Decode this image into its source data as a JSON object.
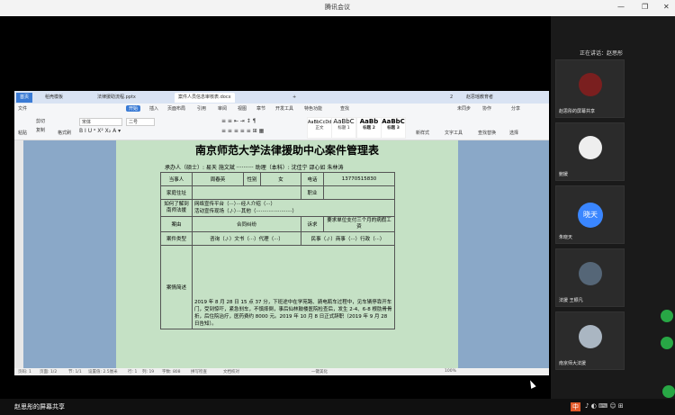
{
  "window": {
    "title": "腾讯会议",
    "min": "—",
    "max": "❐",
    "close": "✕"
  },
  "wps": {
    "tabs": [
      "首页",
      "稻壳模板",
      "法律援助流程.pptx",
      "案件人员信息审核表.docx"
    ],
    "tab_add": "+",
    "tab_count": "2",
    "user": "赵思瑶教育者",
    "menus": [
      "文件",
      "开始",
      "插入",
      "页面布局",
      "引用",
      "审阅",
      "视图",
      "章节",
      "开发工具",
      "特色功能",
      "查找"
    ],
    "tools": {
      "paste": "粘贴",
      "cut": "剪切",
      "copy": "复制",
      "format_painter": "格式刷",
      "font": "宋体",
      "size": "二号",
      "text_tools": "文字工具",
      "find_replace": "查找替换",
      "select": "选择",
      "new_style": "新样式",
      "share": "分享",
      "collab": "未同步",
      "feedback": "协作"
    },
    "styles": [
      {
        "sample": "AaBbCcDd",
        "label": "正文"
      },
      {
        "sample": "AaBbC",
        "label": "标题 1"
      },
      {
        "sample": "AaBb",
        "label": "标题 2"
      },
      {
        "sample": "AaBbC",
        "label": "标题 3"
      }
    ],
    "status": {
      "page": "页码: 1",
      "pages": "页面: 1/2",
      "section": "节: 1/1",
      "setting": "设置值: 2.5厘米",
      "row": "行: 1",
      "col": "列: 19",
      "words": "字数: 808",
      "spell": "拼写检查",
      "doc_check": "文档校对",
      "mode": "一键美化",
      "zoom": "100%"
    }
  },
  "doc": {
    "title": "南京师范大学法律援助中心案件管理表",
    "line1": "承办人（硕士）: 易天 施文斌 ·········· 助理（本科）: 沈佳宁 邵心如 朱林涛",
    "labels": {
      "client": "当事人",
      "client_name": "周春英",
      "gender": "性别",
      "gender_val": "女",
      "phone": "电话",
      "phone_val": "13770515830",
      "address": "家庭住址",
      "job": "职业",
      "how": "如何了解到南师法援",
      "source1": "网络宣传平台（···）···经人介绍（···）",
      "source2": "活动宣传现场（./·）···其他（·······················）",
      "cause": "案由",
      "cause_val": "合同纠纷",
      "claim": "诉求",
      "claim_val": "要求单位支付三个月的病假工资",
      "type": "案件类型",
      "type1": "咨询（./·）文书（···）代理（···）",
      "type2": "民事（./·）商事（···）行政（···）",
      "summary": "案情简述"
    },
    "narrative": "2019 年 8 月 28 日 15 点 37 分，下班途中在学苑路、骑电瓶车过程中，见车辆停靠开车门，受到惊吓，紧急刹车，不慎摔倒，事后仙林鼓楼医院检查后，发生 2-4、6-8 根肋骨骨折，后住院治疗，医药费约 8000 元。2019 年 10 月 8 日正式辞职（2019 年 9 月 28 日告知）。"
  },
  "meeting": {
    "speaking": "正在讲话：赵思彤",
    "participants": [
      {
        "name": "赵思彤的屏幕共享",
        "type": "image"
      },
      {
        "name": "鲍媛",
        "type": "dog"
      },
      {
        "name": "朱晓天",
        "type": "text",
        "avatar_text": "晓天"
      },
      {
        "name": "法援 王颖凡",
        "type": "image"
      },
      {
        "name": "南京师大法援",
        "type": "image"
      }
    ]
  },
  "bottombar": {
    "share_label": "赵思彤的屏幕共享",
    "tray_lang": "中",
    "tray_icons": "♪ ◐ ⌨ ☺ ⊞"
  }
}
